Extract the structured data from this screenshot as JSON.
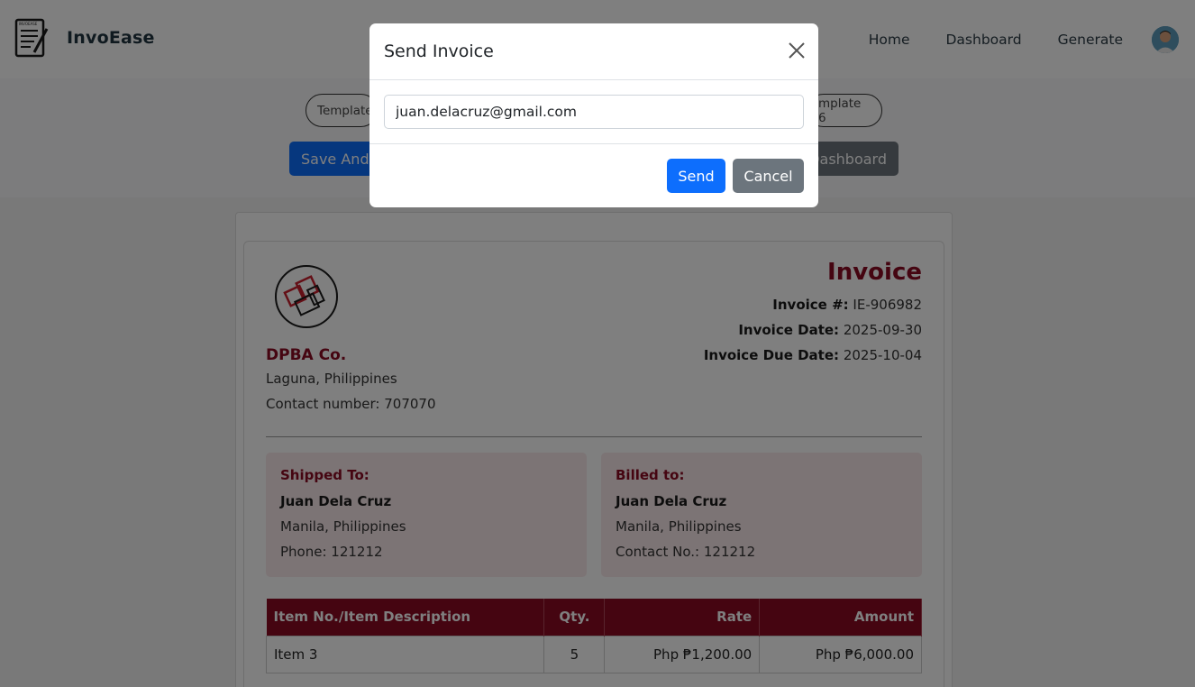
{
  "navbar": {
    "brand": "InvoEase",
    "logo_text": "INVOEASE",
    "links": [
      "Home",
      "Dashboard",
      "Generate"
    ]
  },
  "templates": {
    "first": "Template",
    "last": "mplate 6"
  },
  "actions": {
    "save": "Save And",
    "dashboard": "Dashboard"
  },
  "invoice": {
    "title": "Invoice",
    "number_label": "Invoice #:",
    "number": "IE-906982",
    "date_label": "Invoice Date:",
    "date": "2025-09-30",
    "due_label": "Invoice Due Date:",
    "due": "2025-10-04",
    "company": {
      "name": "DPBA Co.",
      "address": "Laguna, Philippines",
      "contact": "Contact number: 707070"
    },
    "shipped": {
      "title": "Shipped To:",
      "name": "Juan Dela Cruz",
      "address": "Manila, Philippines",
      "phone": "Phone: 121212"
    },
    "billed": {
      "title": "Billed to:",
      "name": "Juan Dela Cruz",
      "address": "Manila, Philippines",
      "contact": "Contact No.: 121212"
    },
    "table": {
      "headers": [
        "Item No./Item Description",
        "Qty.",
        "Rate",
        "Amount"
      ],
      "rows": [
        [
          "Item 3",
          "5",
          "Php ₱1,200.00",
          "Php ₱6,000.00"
        ]
      ]
    }
  },
  "modal": {
    "title": "Send Invoice",
    "email_value": "juan.delacruz@gmail.com",
    "send": "Send",
    "cancel": "Cancel"
  },
  "colors": {
    "accent": "#8b0a23",
    "primary": "#0d6efd",
    "secondary": "#6c757d"
  }
}
